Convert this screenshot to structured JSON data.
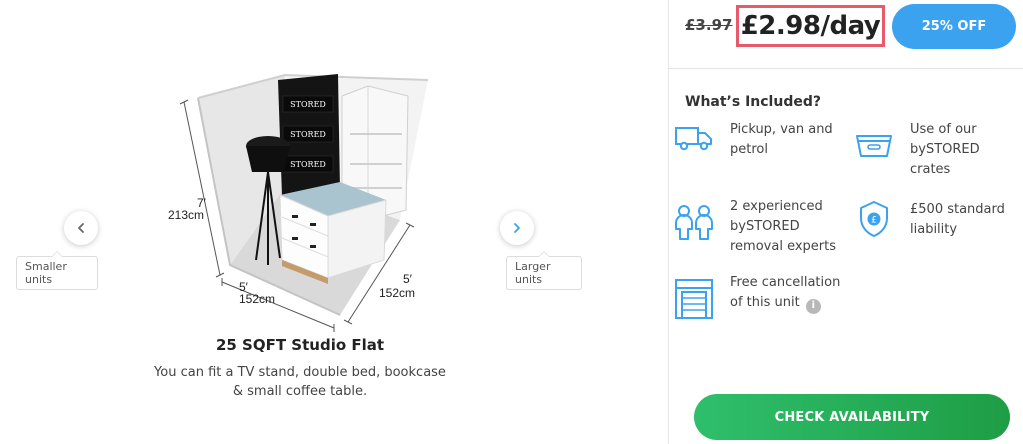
{
  "navigation": {
    "prev_label": "Smaller units",
    "next_label": "Larger units"
  },
  "unit": {
    "title": "25 SQFT Studio Flat",
    "description": "You can fit a TV stand, double bed, bookcase & small coffee table.",
    "dimensions": {
      "height_ft": "7′",
      "height_cm": "213cm",
      "width_ft": "5′",
      "width_cm": "152cm",
      "depth_ft": "5′",
      "depth_cm": "152cm"
    },
    "box_brand": "STORED"
  },
  "pricing": {
    "old_price": "£3.97",
    "price": "£2.98/day",
    "discount_label": "25% OFF",
    "highlight_color": "#e85a6b",
    "discount_color": "#3ba2ef"
  },
  "included": {
    "title": "What’s Included?",
    "items": [
      {
        "icon": "van-icon",
        "text": "Pickup, van and petrol"
      },
      {
        "icon": "crate-icon",
        "text": "Use of our bySTORED crates"
      },
      {
        "icon": "movers-icon",
        "text": "2 experienced bySTORED removal experts"
      },
      {
        "icon": "shield-icon",
        "text": "£500 standard liability"
      },
      {
        "icon": "storage-unit-icon",
        "text": "Free cancellation of this unit",
        "info": "i"
      }
    ]
  },
  "cta": {
    "label": "CHECK AVAILABILITY",
    "color": "#27b25a"
  }
}
